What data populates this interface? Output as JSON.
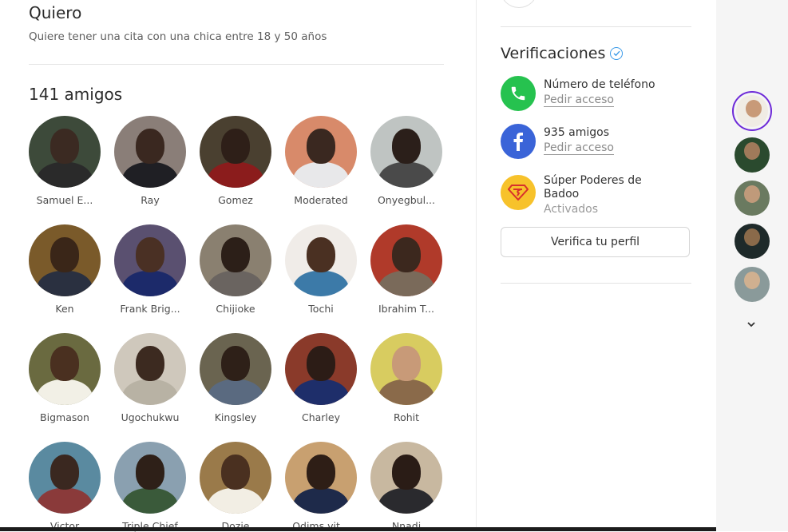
{
  "preferences": {
    "title": "Quiero",
    "subtitle": "Quiere tener una cita con una chica entre 18 y 50 años"
  },
  "friends": {
    "title": "141 amigos",
    "items": [
      {
        "name": "Samuel E...",
        "bg": "#3d4a3a",
        "skin": "#3b2a22",
        "shirt": "#2a2a2a"
      },
      {
        "name": "Ray",
        "bg": "#8a7e78",
        "skin": "#3a2820",
        "shirt": "#1f1f24"
      },
      {
        "name": "Gomez",
        "bg": "#4a4030",
        "skin": "#2e1f18",
        "shirt": "#8b1c1c"
      },
      {
        "name": "Moderated",
        "bg": "#d88a6a",
        "skin": "#3a2820",
        "shirt": "#e8e8ea"
      },
      {
        "name": "Onyegbul...",
        "bg": "#bfc4c2",
        "skin": "#2b1f1a",
        "shirt": "#4a4a4a"
      },
      {
        "name": "Ken",
        "bg": "#7a5a2a",
        "skin": "#3a2618",
        "shirt": "#2a3040"
      },
      {
        "name": "Frank Brig...",
        "bg": "#5a5070",
        "skin": "#4a3024",
        "shirt": "#1c2a6a"
      },
      {
        "name": "Chijioke",
        "bg": "#8a8070",
        "skin": "#2c1f18",
        "shirt": "#6a6460"
      },
      {
        "name": "Tochi",
        "bg": "#f0ece8",
        "skin": "#4a3022",
        "shirt": "#3c7aa8"
      },
      {
        "name": "Ibrahim T...",
        "bg": "#b03a2a",
        "skin": "#3c281e",
        "shirt": "#7a6a5a"
      },
      {
        "name": "Bigmason",
        "bg": "#6a6a40",
        "skin": "#4a3020",
        "shirt": "#f2f0e6"
      },
      {
        "name": "Ugochukwu",
        "bg": "#cfc8bc",
        "skin": "#3c2a20",
        "shirt": "#b8b2a4"
      },
      {
        "name": "Kingsley",
        "bg": "#6a6450",
        "skin": "#2e2018",
        "shirt": "#5a6a80"
      },
      {
        "name": "Charley",
        "bg": "#8a3a2a",
        "skin": "#2c1c16",
        "shirt": "#1e2e6a"
      },
      {
        "name": "Rohit",
        "bg": "#d8cc60",
        "skin": "#c89a78",
        "shirt": "#8a6a4a"
      },
      {
        "name": "Victor",
        "bg": "#5a8aa0",
        "skin": "#3a2820",
        "shirt": "#8a3a3a"
      },
      {
        "name": "Triple Chief",
        "bg": "#8aa0b0",
        "skin": "#2e2018",
        "shirt": "#3a5a3a"
      },
      {
        "name": "Dozie",
        "bg": "#9a7a4a",
        "skin": "#4a3020",
        "shirt": "#f2eee4"
      },
      {
        "name": "Odims vit...",
        "bg": "#c8a070",
        "skin": "#2e1e16",
        "shirt": "#1e2a4a"
      },
      {
        "name": "Nnadi",
        "bg": "#c8b8a0",
        "skin": "#2a1c16",
        "shirt": "#2a2a2e"
      }
    ]
  },
  "verifications": {
    "title": "Verificaciones",
    "items": [
      {
        "label": "Número de teléfono",
        "action": "Pedir acceso",
        "icon": "phone-icon",
        "color": "#26c24f"
      },
      {
        "label": "935 amigos",
        "action": "Pedir acceso",
        "icon": "facebook-icon",
        "color": "#3a64d8"
      },
      {
        "label": "Súper Poderes de Badoo",
        "status": "Activados",
        "icon": "superpowers-icon",
        "color": "#f7c22b"
      }
    ],
    "button": "Verifica tu perfil"
  },
  "sidebar": {
    "avatars": [
      {
        "bg": "#f0ece4",
        "skin": "#c89a78",
        "active": true
      },
      {
        "bg": "#2a4a2e",
        "skin": "#a07a5a"
      },
      {
        "bg": "#6a7a60",
        "skin": "#c09a7a"
      },
      {
        "bg": "#1e2a2a",
        "skin": "#8a6a4a"
      },
      {
        "bg": "#8a9a9a",
        "skin": "#d0b090"
      }
    ]
  }
}
